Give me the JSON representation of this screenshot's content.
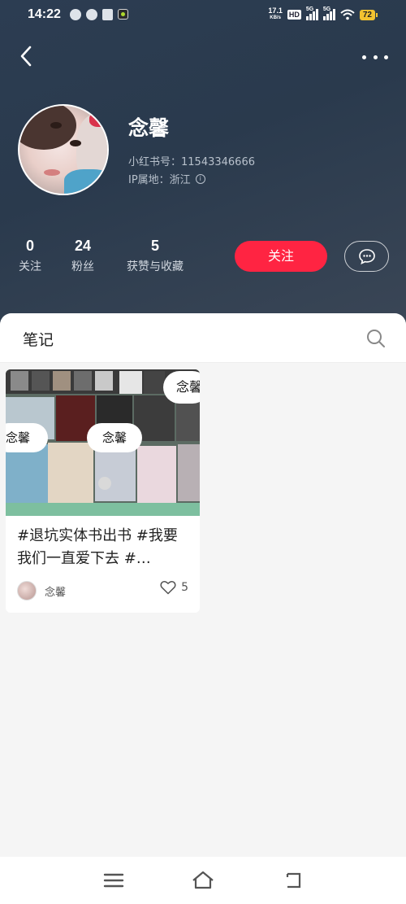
{
  "status_bar": {
    "time": "14:22",
    "net_speed_value": "17.1",
    "net_speed_unit": "KB/s",
    "hd_label": "HD",
    "signal1_label": "5G",
    "signal2_label": "5G",
    "battery": "72"
  },
  "icons": {
    "back": "chevron-left-icon",
    "more": "more-horizontal-icon",
    "message": "chat-bubble-icon",
    "search": "search-icon",
    "like": "heart-icon",
    "menu": "menu-icon",
    "home": "home-icon",
    "back_nav": "return-icon"
  },
  "profile": {
    "name": "念馨",
    "red_id": "小红书号：11543346666",
    "ip_location": "IP属地：浙江",
    "info_icon": "ⓘ"
  },
  "stats": [
    {
      "value": "0",
      "label": "关注"
    },
    {
      "value": "24",
      "label": "粉丝"
    },
    {
      "value": "5",
      "label": "获赞与收藏"
    }
  ],
  "actions": {
    "follow_label": "关注"
  },
  "tabs": {
    "notes_label": "笔记"
  },
  "note": {
    "title": "#退坑实体书出书 #我要我们一直爱下去 #…",
    "cover_bubbles": [
      "念馨",
      "念馨",
      "念馨"
    ],
    "author": "念馨",
    "likes": "5"
  },
  "colors": {
    "accent": "#ff2442",
    "header_bg": "#2c3d52"
  }
}
